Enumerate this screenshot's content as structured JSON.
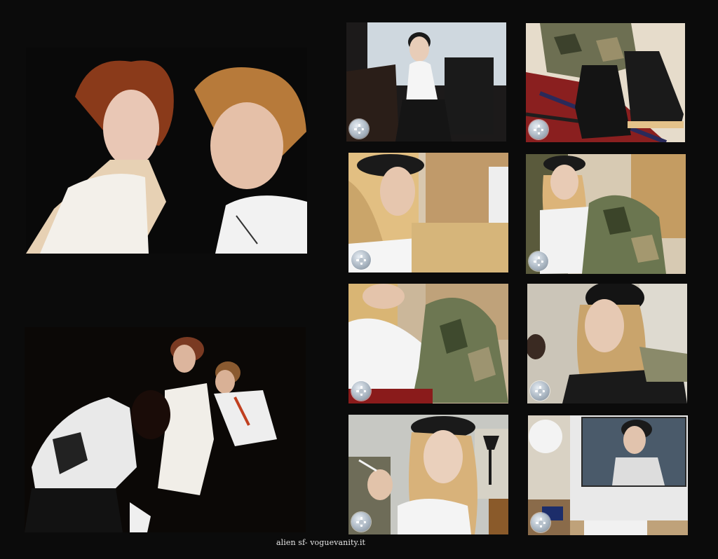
{
  "caption": "alien sf- voguevanity.it",
  "photos": [
    {
      "id": "p1",
      "subject": "two-models-portrait"
    },
    {
      "id": "p2",
      "subject": "group-on-dark-backdrop"
    },
    {
      "id": "p3",
      "subject": "model-at-desk-with-lamp"
    },
    {
      "id": "p4",
      "subject": "black-combat-boots-on-plaid"
    },
    {
      "id": "p5",
      "subject": "model-profile-with-beret"
    },
    {
      "id": "p6",
      "subject": "model-seated-camouflage-pants"
    },
    {
      "id": "p7",
      "subject": "model-reclining-camouflage"
    },
    {
      "id": "p8",
      "subject": "model-closeup-beret"
    },
    {
      "id": "p9",
      "subject": "model-smoking-with-lamp"
    },
    {
      "id": "p10",
      "subject": "computer-screen-with-model"
    }
  ],
  "colors": {
    "background": "#0b0b0b",
    "caption_text": "#e6e6e6",
    "zoom_button": "#aab6c2"
  }
}
